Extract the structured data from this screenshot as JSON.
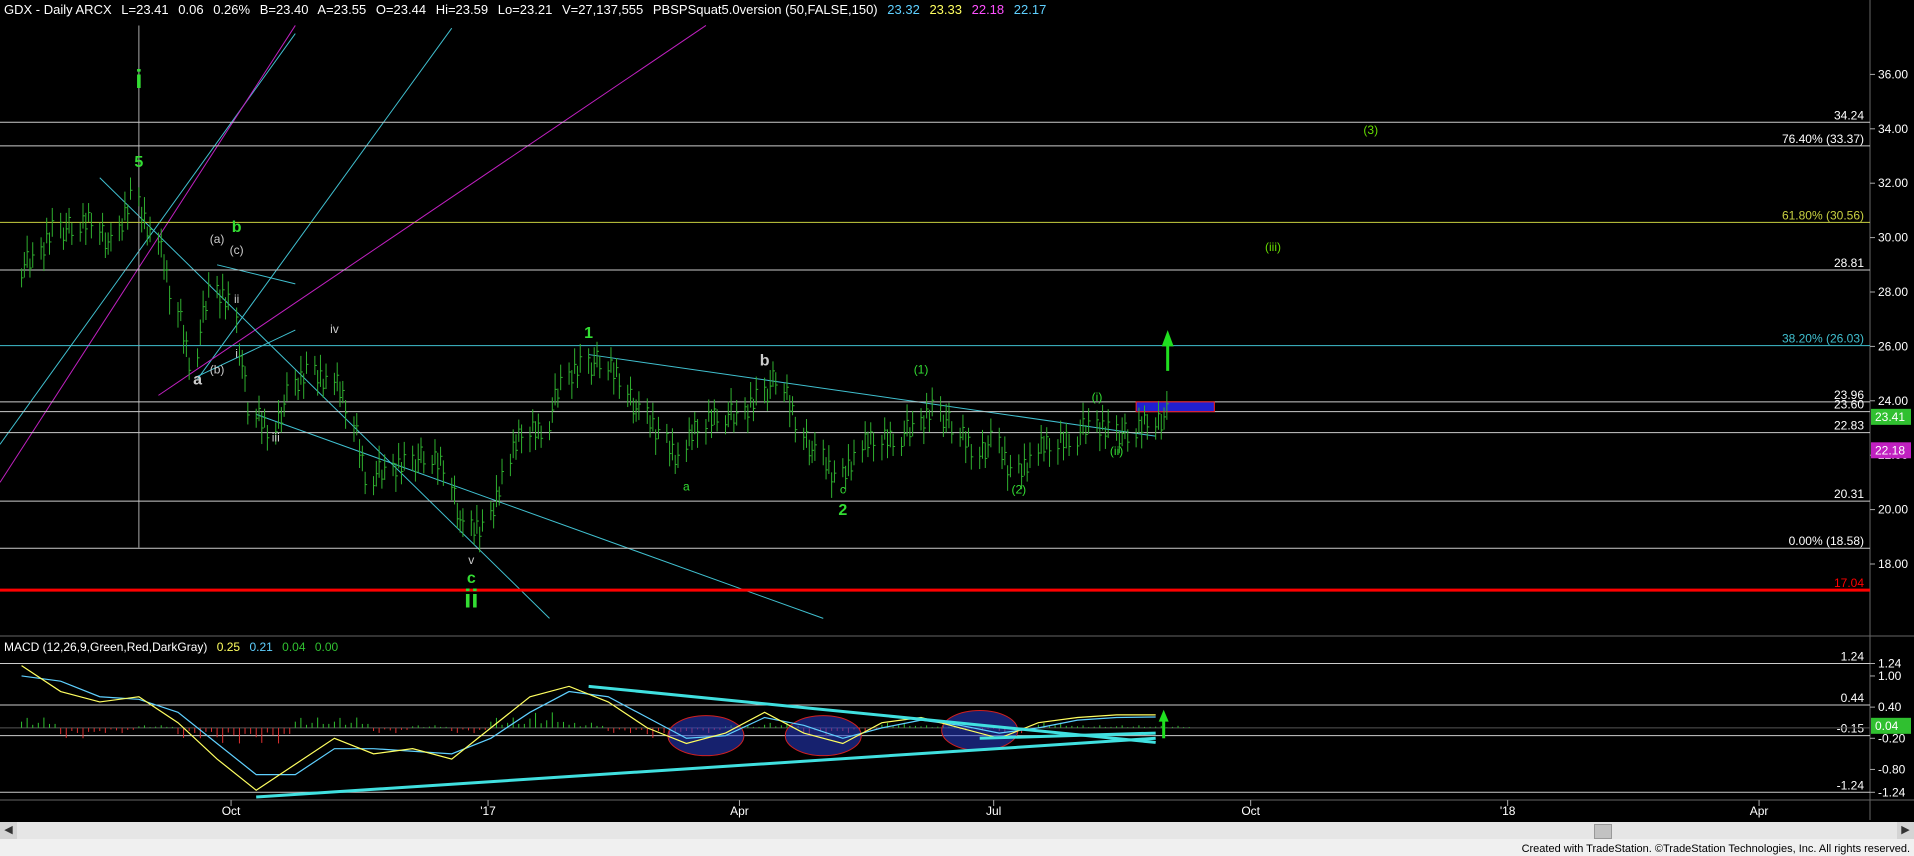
{
  "header": {
    "title": "GDX - Daily  ARCX",
    "last": "L=23.41",
    "change": "0.06",
    "change_pct": "0.26%",
    "bid": "B=23.40",
    "ask": "A=23.55",
    "open": "O=23.44",
    "high": "Hi=23.59",
    "low": "Lo=23.21",
    "volume": "V=27,137,555",
    "indicator": "PBSPSquat5.0version (50,FALSE,150)",
    "ind_values": [
      "23.32",
      "23.33",
      "22.18",
      "22.17"
    ],
    "ind_colors": [
      "#5fd0ff",
      "#ffff60",
      "#ff50ff",
      "#5fd0ff"
    ]
  },
  "macd_header": {
    "label": "MACD (12,26,9,Green,Red,DarkGray)",
    "values": [
      "0.25",
      "0.21",
      "0.04",
      "0.00"
    ],
    "colors": [
      "#ffff60",
      "#5fd0ff",
      "#30c030",
      "#30c030"
    ]
  },
  "footer": "Created with TradeStation. ©TradeStation Technologies, Inc. All rights reserved.",
  "colors": {
    "bars": "#2fb02f",
    "wave_labels": "#33dd33",
    "fib": "#c8d040",
    "cyan": "#40c0d0",
    "magenta": "#c020c0",
    "red_line": "#ff0000",
    "box": "#2020d0"
  },
  "chart_data": [
    {
      "type": "line",
      "title": "GDX - Daily",
      "xlabel": "",
      "ylabel": "",
      "x_ticks": [
        "Oct",
        "'17",
        "Apr",
        "Jul",
        "Oct",
        "'18",
        "Apr"
      ],
      "y_ticks": [
        "18.00",
        "20.00",
        "22.00",
        "24.00",
        "26.00",
        "28.00",
        "30.00",
        "32.00",
        "34.00",
        "36.00"
      ],
      "ylim": [
        15.5,
        38.0
      ],
      "x": [
        "2016-07-18",
        "2016-07-25",
        "2016-08-01",
        "2016-08-08",
        "2016-08-15",
        "2016-08-22",
        "2016-08-29",
        "2016-09-05",
        "2016-09-12",
        "2016-09-19",
        "2016-09-26",
        "2016-10-03",
        "2016-10-10",
        "2016-10-17",
        "2016-10-24",
        "2016-10-31",
        "2016-11-07",
        "2016-11-14",
        "2016-11-21",
        "2016-11-28",
        "2016-12-05",
        "2016-12-12",
        "2016-12-19",
        "2016-12-26",
        "2017-01-02",
        "2017-01-09",
        "2017-01-16",
        "2017-01-23",
        "2017-01-30",
        "2017-02-06",
        "2017-02-13",
        "2017-02-20",
        "2017-02-27",
        "2017-03-06",
        "2017-03-13",
        "2017-03-20",
        "2017-03-27",
        "2017-04-03",
        "2017-04-10",
        "2017-04-17",
        "2017-04-24",
        "2017-05-01",
        "2017-05-08",
        "2017-05-15",
        "2017-05-22",
        "2017-05-29",
        "2017-06-05",
        "2017-06-12",
        "2017-06-19",
        "2017-06-26",
        "2017-07-03",
        "2017-07-10",
        "2017-07-17",
        "2017-07-24",
        "2017-07-31",
        "2017-08-07",
        "2017-08-14",
        "2017-08-21",
        "2017-08-28"
      ],
      "series": [
        {
          "name": "GDX",
          "values": [
            29.0,
            30.5,
            30.2,
            30.8,
            29.6,
            31.5,
            30.3,
            28.0,
            25.6,
            27.9,
            27.8,
            23.6,
            23.0,
            24.1,
            25.1,
            24.9,
            23.8,
            21.4,
            21.2,
            21.9,
            21.8,
            21.7,
            19.1,
            19.3,
            21.4,
            22.9,
            23.1,
            24.5,
            25.5,
            25.3,
            24.9,
            23.4,
            22.7,
            22.0,
            23.1,
            23.7,
            23.2,
            24.3,
            24.7,
            23.3,
            21.9,
            21.1,
            22.1,
            22.6,
            22.8,
            22.8,
            23.9,
            22.9,
            22.3,
            22.4,
            21.3,
            22.0,
            22.4,
            22.8,
            22.9,
            23.1,
            22.6,
            23.4,
            23.41
          ]
        }
      ],
      "horizontal_levels": [
        {
          "label": "34.24",
          "value": 34.24
        },
        {
          "label": "76.40% (33.37)",
          "value": 33.37
        },
        {
          "label": "61.80% (30.56)",
          "value": 30.56
        },
        {
          "label": "28.81",
          "value": 28.81
        },
        {
          "label": "38.20% (26.03)",
          "value": 26.03
        },
        {
          "label": "23.96",
          "value": 23.96
        },
        {
          "label": "23.60",
          "value": 23.6
        },
        {
          "label": "22.83",
          "value": 22.83
        },
        {
          "label": "20.31",
          "value": 20.31
        },
        {
          "label": "0.00% (18.58)",
          "value": 18.58
        },
        {
          "label": "17.04",
          "value": 17.04
        }
      ],
      "price_tags": [
        {
          "label": "23.41",
          "value": 23.41,
          "color": "#30c030"
        },
        {
          "label": "22.18",
          "value": 22.18,
          "color": "#c020c0"
        }
      ],
      "wave_labels": [
        {
          "text": "i",
          "date": "2016-08-29",
          "value": 35.5
        },
        {
          "text": "5",
          "date": "2016-08-29",
          "value": 32.6
        },
        {
          "text": "(a)",
          "date": "2016-09-26",
          "value": 29.8
        },
        {
          "text": "b",
          "date": "2016-10-03",
          "value": 30.2
        },
        {
          "text": "(c)",
          "date": "2016-10-03",
          "value": 29.4
        },
        {
          "text": "ii",
          "date": "2016-10-03",
          "value": 27.6
        },
        {
          "text": "i",
          "date": "2016-10-03",
          "value": 25.6
        },
        {
          "text": "a",
          "date": "2016-09-19",
          "value": 24.6
        },
        {
          "text": "(b)",
          "date": "2016-09-26",
          "value": 25.0
        },
        {
          "text": "iv",
          "date": "2016-11-07",
          "value": 26.5
        },
        {
          "text": "iii",
          "date": "2016-10-17",
          "value": 22.5
        },
        {
          "text": "v",
          "date": "2016-12-26",
          "value": 18.0
        },
        {
          "text": "c",
          "date": "2016-12-26",
          "value": 17.3
        },
        {
          "text": "ii",
          "date": "2016-12-26",
          "value": 16.4
        },
        {
          "text": "1",
          "date": "2017-02-06",
          "value": 26.3
        },
        {
          "text": "a",
          "date": "2017-03-13",
          "value": 20.7
        },
        {
          "text": "b",
          "date": "2017-04-10",
          "value": 25.3
        },
        {
          "text": "c",
          "date": "2017-05-08",
          "value": 20.6
        },
        {
          "text": "2",
          "date": "2017-05-08",
          "value": 19.8
        },
        {
          "text": "(1)",
          "date": "2017-06-05",
          "value": 25.0
        },
        {
          "text": "(2)",
          "date": "2017-07-10",
          "value": 20.6
        },
        {
          "text": "(i)",
          "date": "2017-08-07",
          "value": 24.0
        },
        {
          "text": "(ii)",
          "date": "2017-08-14",
          "value": 22.0
        },
        {
          "text": "(iii)",
          "date": "2017-10-09",
          "value": 29.5
        },
        {
          "text": "(3)",
          "date": "2017-11-13",
          "value": 33.8
        }
      ]
    },
    {
      "type": "bar",
      "title": "MACD (12,26,9,Green,Red,DarkGray)",
      "xlabel": "",
      "ylabel": "",
      "y_ticks": [
        "-1.24",
        "-0.80",
        "-0.20",
        "0.40",
        "1.00",
        "1.24"
      ],
      "ylim": [
        -1.35,
        1.5
      ],
      "horizontal_levels": [
        {
          "label": "1.24",
          "value": 1.24
        },
        {
          "label": "0.44",
          "value": 0.44
        },
        {
          "label": "-0.15",
          "value": -0.15
        },
        {
          "label": "-1.24",
          "value": -1.24
        }
      ],
      "price_tags": [
        {
          "label": "0.04",
          "value": 0.04,
          "color": "#30c030"
        }
      ],
      "x": [
        "2016-07-18",
        "2016-08-01",
        "2016-08-15",
        "2016-08-29",
        "2016-09-12",
        "2016-09-26",
        "2016-10-10",
        "2016-10-24",
        "2016-11-07",
        "2016-11-21",
        "2016-12-05",
        "2016-12-19",
        "2017-01-02",
        "2017-01-16",
        "2017-01-30",
        "2017-02-13",
        "2017-02-27",
        "2017-03-13",
        "2017-03-27",
        "2017-04-10",
        "2017-04-24",
        "2017-05-08",
        "2017-05-22",
        "2017-06-05",
        "2017-06-19",
        "2017-07-03",
        "2017-07-17",
        "2017-07-31",
        "2017-08-14",
        "2017-08-28"
      ],
      "series": [
        {
          "name": "MACD",
          "values": [
            1.2,
            0.7,
            0.5,
            0.6,
            0.1,
            -0.6,
            -1.2,
            -0.7,
            -0.2,
            -0.5,
            -0.4,
            -0.6,
            0.0,
            0.6,
            0.8,
            0.5,
            0.0,
            -0.3,
            -0.1,
            0.3,
            -0.1,
            -0.3,
            0.1,
            0.2,
            0.0,
            -0.2,
            0.1,
            0.2,
            0.25,
            0.25
          ]
        },
        {
          "name": "Signal",
          "values": [
            1.0,
            0.9,
            0.6,
            0.55,
            0.3,
            -0.3,
            -0.9,
            -0.9,
            -0.4,
            -0.4,
            -0.45,
            -0.5,
            -0.2,
            0.3,
            0.7,
            0.6,
            0.2,
            -0.2,
            -0.15,
            0.2,
            0.05,
            -0.2,
            0.0,
            0.15,
            0.05,
            -0.1,
            0.0,
            0.15,
            0.2,
            0.21
          ]
        },
        {
          "name": "Histogram",
          "values": [
            0.2,
            -0.2,
            -0.1,
            0.05,
            -0.2,
            -0.3,
            -0.3,
            0.2,
            0.2,
            -0.1,
            0.05,
            -0.1,
            0.2,
            0.3,
            0.1,
            -0.1,
            -0.2,
            -0.1,
            0.05,
            0.1,
            -0.15,
            -0.1,
            0.1,
            0.05,
            -0.05,
            -0.1,
            0.1,
            0.05,
            0.05,
            0.04
          ]
        }
      ]
    }
  ]
}
